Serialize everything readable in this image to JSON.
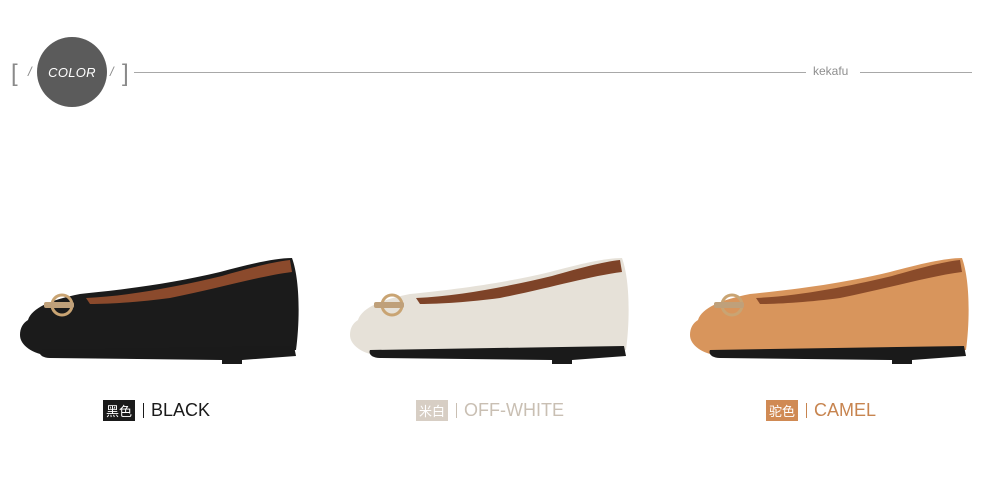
{
  "header": {
    "label": "COLOR",
    "brand": "kekafu",
    "bracket_left": "[",
    "bracket_right": "]",
    "slash": "/"
  },
  "products": [
    {
      "tag": "黑色",
      "name": "BLACK",
      "tag_bg": "#1a1a1a",
      "text_color": "#1a1a1a",
      "upper": "#1b1b1b",
      "lining": "#8b4a2c"
    },
    {
      "tag": "米白",
      "name": "OFF-WHITE",
      "tag_bg": "#d7cec4",
      "text_color": "#c9bfb3",
      "upper": "#e6e1d8",
      "lining": "#7e4328"
    },
    {
      "tag": "驼色",
      "name": "CAMEL",
      "tag_bg": "#d08a54",
      "text_color": "#c7844f",
      "upper": "#d8955c",
      "lining": "#8a4b2a"
    }
  ]
}
